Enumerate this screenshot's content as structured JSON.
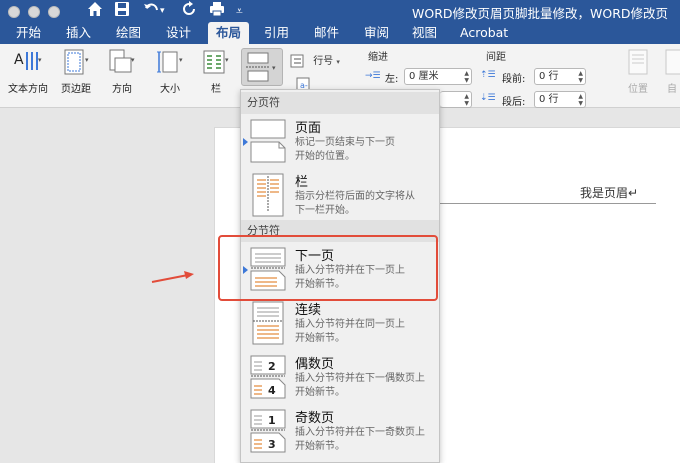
{
  "window": {
    "title": "WORD修改页眉页脚批量修改，WORD修改页"
  },
  "tabs": [
    {
      "label": "开始"
    },
    {
      "label": "插入"
    },
    {
      "label": "绘图"
    },
    {
      "label": "设计"
    },
    {
      "label": "布局",
      "active": true
    },
    {
      "label": "引用"
    },
    {
      "label": "邮件"
    },
    {
      "label": "审阅"
    },
    {
      "label": "视图"
    },
    {
      "label": "Acrobat"
    }
  ],
  "ribbon": {
    "text_direction": "文本方向",
    "margins": "页边距",
    "orientation": "方向",
    "size": "大小",
    "columns": "栏",
    "line_numbers": "行号",
    "indent": {
      "label": "缩进",
      "left_label": "左:",
      "left_value": "0 厘米"
    },
    "spacing": {
      "label": "间距",
      "before_label": "段前:",
      "before_value": "0 行",
      "after_label": "段后:",
      "after_value": "0 行"
    },
    "position": "位置",
    "wrap": "自"
  },
  "document": {
    "header_text": "我是页眉↵"
  },
  "breaks_menu": {
    "page_breaks_label": "分页符",
    "section_breaks_label": "分节符",
    "items": [
      {
        "title": "页面",
        "desc_1": "标记一页结束与下一页",
        "desc_2": "开始的位置。"
      },
      {
        "title": "栏",
        "desc_1": "指示分栏符后面的文字将从",
        "desc_2": "下一栏开始。"
      },
      {
        "title": "下一页",
        "desc_1": "插入分节符并在下一页上",
        "desc_2": "开始新节。"
      },
      {
        "title": "连续",
        "desc_1": "插入分节符并在同一页上",
        "desc_2": "开始新节。"
      },
      {
        "title": "偶数页",
        "desc_1": "插入分节符并在下一偶数页上",
        "desc_2": "开始新节。",
        "icon_num_a": "2",
        "icon_num_b": "4"
      },
      {
        "title": "奇数页",
        "desc_1": "插入分节符并在下一奇数页上",
        "desc_2": "开始新节。",
        "icon_num_a": "1",
        "icon_num_b": "3"
      }
    ]
  },
  "colors": {
    "title_bar": "#2b579a",
    "highlight_box": "#e24c3a",
    "selection_triangle": "#3d78d8",
    "section_icon_lines": "#e8a060"
  }
}
